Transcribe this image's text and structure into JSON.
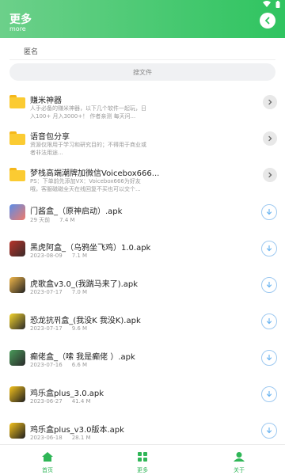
{
  "header": {
    "title": "更多",
    "subtitle": "more"
  },
  "anon": {
    "label": "匿名"
  },
  "search": {
    "placeholder": "搜文件"
  },
  "folders": [
    {
      "title": "赚米神器",
      "desc": "人手必备的赚米神器，以下几个软件一起玩，日入100+ 月入3000+！ 作者亲测 每天问..."
    },
    {
      "title": "语音包分享",
      "desc": "资源仅限用于学习和研究目的；不得用于商业或者非法用途..."
    },
    {
      "title": "梦栈高端潮牌加微信Voicebox666...",
      "desc": "PS：下单前先添加VX：Voicebox666为好友哦，客服磁磁全天在线回复不买也可以交个..."
    }
  ],
  "apks": [
    {
      "title": "门酱盒_（原神启动）.apk",
      "date": "29 天前",
      "size": "7.4 M"
    },
    {
      "title": "黑虎阿盒_（乌鸦坐飞鸡）1.0.apk",
      "date": "2023-08-09",
      "size": "7.1 M"
    },
    {
      "title": "虎歌盒v3.0_(我踹马来了).apk",
      "date": "2023-07-17",
      "size": "7.0 M"
    },
    {
      "title": "恐龙抗퓌盒_(我没K 我没K).apk",
      "date": "2023-07-17",
      "size": "9.6 M"
    },
    {
      "title": "癫佬盒_（嗦 我是癫佬 ）.apk",
      "date": "2023-07-16",
      "size": "6.6 M"
    },
    {
      "title": "鸡乐盒plus_3.0.apk",
      "date": "2023-06-27",
      "size": "41.4 M"
    },
    {
      "title": "鸡乐盒plus_v3.0版本.apk",
      "date": "2023-06-18",
      "size": "28.1 M"
    }
  ],
  "tabs": {
    "home": "首页",
    "more": "更多",
    "about": "关于"
  },
  "colors": {
    "accent": "#2fb657",
    "folder": "#fbcb32",
    "download": "#6ab4f0"
  }
}
